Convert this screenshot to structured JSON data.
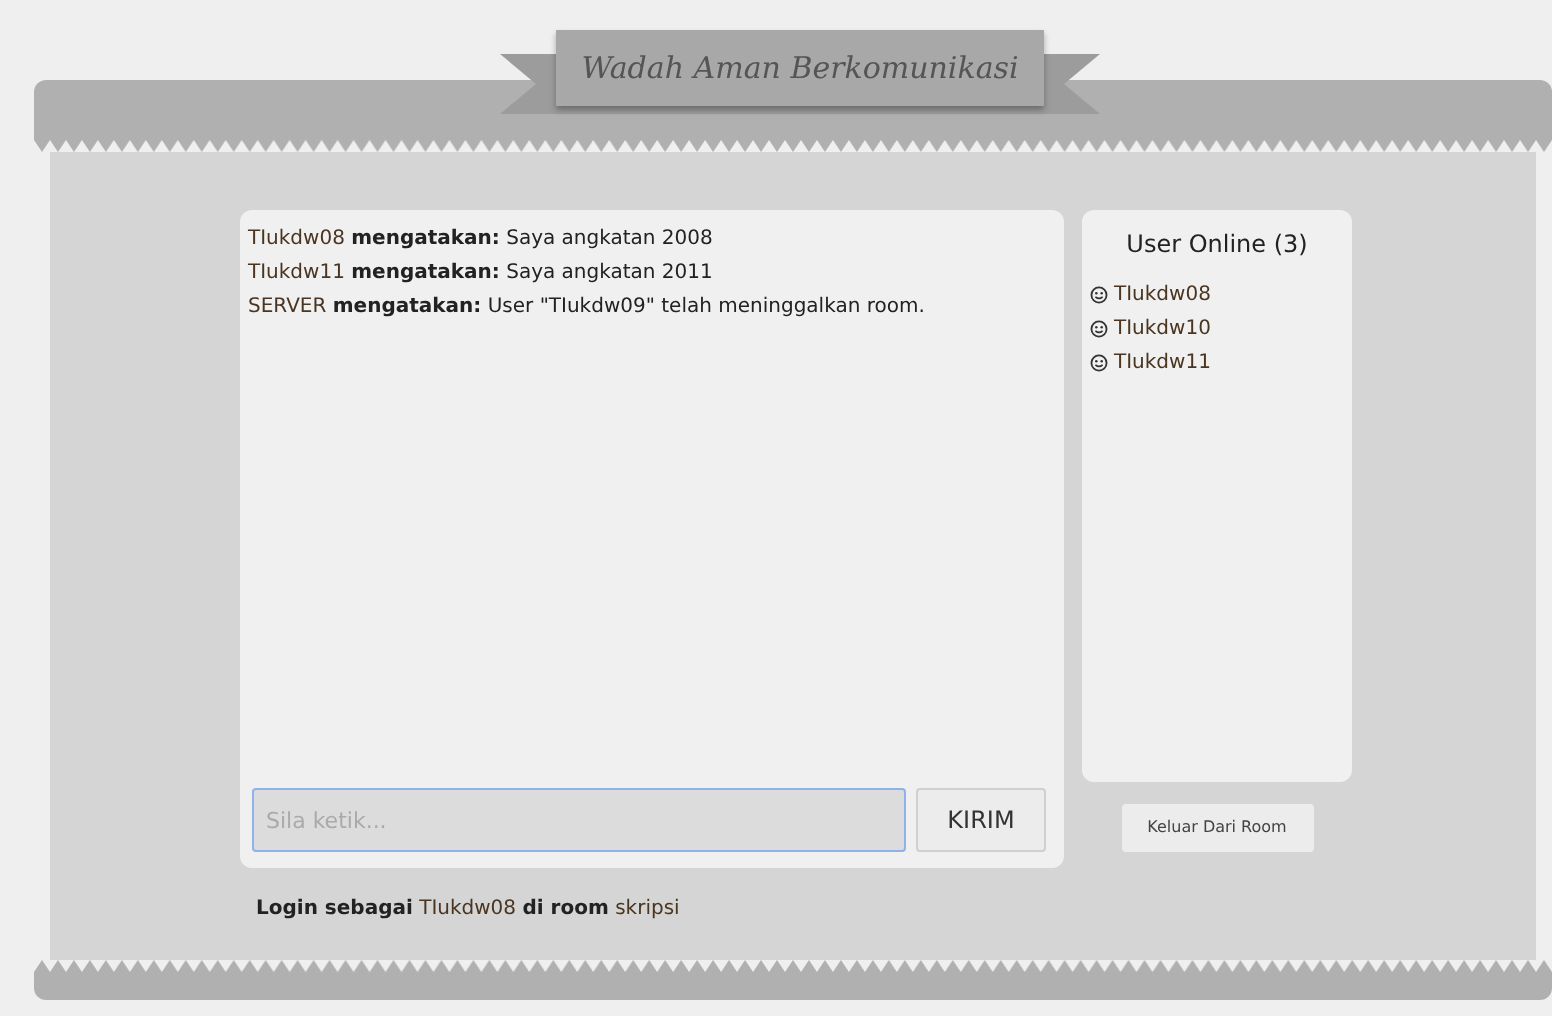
{
  "header": {
    "title": "Wadah Aman Berkomunikasi"
  },
  "chat": {
    "messages": [
      {
        "sender": "TIukdw08",
        "verb": "mengatakan:",
        "text": "Saya angkatan 2008"
      },
      {
        "sender": "TIukdw11",
        "verb": "mengatakan:",
        "text": "Saya angkatan 2011"
      },
      {
        "sender": "SERVER",
        "verb": "mengatakan:",
        "text": "User \"TIukdw09\" telah meninggalkan room."
      }
    ],
    "input": {
      "placeholder": "Sila ketik..."
    },
    "send_button": "KIRIM"
  },
  "online": {
    "title": "User Online (3)",
    "users": [
      "TIukdw08",
      "TIukdw10",
      "TIukdw11"
    ],
    "leave_button": "Keluar Dari Room"
  },
  "login": {
    "prefix": "Login sebagai",
    "user": "TIukdw08",
    "middle": "di room",
    "room": "skripsi"
  }
}
